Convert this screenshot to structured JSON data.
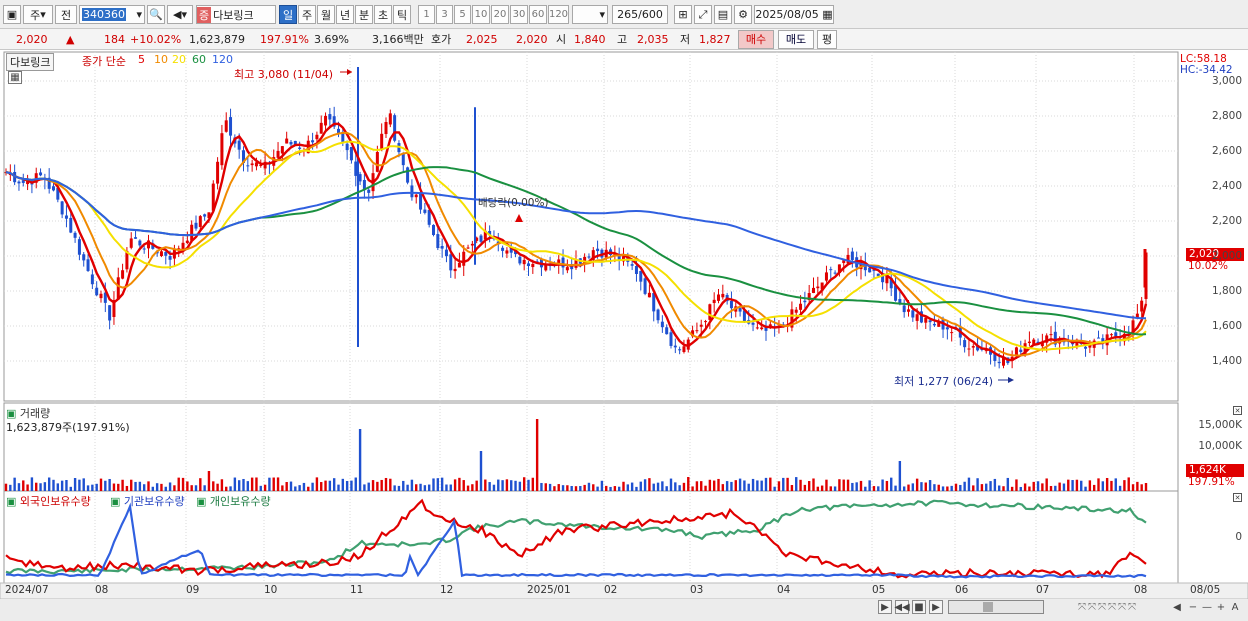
{
  "toolbar": {
    "market_type": "주",
    "unit": "전",
    "code": "340360",
    "stock_name": "다보링크",
    "stock_badge": "증",
    "periods": [
      "일",
      "주",
      "월",
      "년",
      "분",
      "초",
      "틱"
    ],
    "active_period": "일",
    "minute_steps": [
      "1",
      "3",
      "5",
      "10",
      "20",
      "30",
      "60",
      "120"
    ],
    "count": "265",
    "count_max": "/600",
    "date": "2025/08/05"
  },
  "quote": {
    "price": "2,020",
    "change_arrow": "▲",
    "change": "184",
    "change_pct": "+10.02%",
    "volume": "1,623,879",
    "volume_ratio": "197.91%",
    "turnover": "3.69%",
    "amount": "3,166백만",
    "bid_label": "호가",
    "bid": "2,025",
    "ask": "2,020",
    "open_label": "시",
    "open": "1,840",
    "high_label": "고",
    "high": "2,035",
    "low_label": "저",
    "low": "1,827",
    "buy_label": "매수",
    "sell_label": "매도",
    "eval_label": "평"
  },
  "legend": {
    "name": "다보링크",
    "ma_title": "종가 단순",
    "ma_periods": [
      "5",
      "10",
      "20",
      "60",
      "120"
    ]
  },
  "annotations": {
    "high": "최고 3,080 (11/04)",
    "low": "최저 1,277 (06/24)",
    "dividend": "배당락(0.00%)",
    "lc": "LC:58.18",
    "hc": "HC:-34.42"
  },
  "price_tag": {
    "price": "2,020",
    "pct": "10.02%"
  },
  "y_axis": [
    "3,000",
    "2,800",
    "2,600",
    "2,400",
    "2,200",
    "2,000",
    "1,800",
    "1,600",
    "1,400"
  ],
  "volume_panel": {
    "title": "거래량",
    "value": "1,623,879주(197.91%)",
    "y_axis": [
      "15,000K",
      "10,000K"
    ],
    "tag_value": "1,624K",
    "tag_pct": "197.91%"
  },
  "holdings_panel": {
    "series": [
      "외국인보유수량",
      "기관보유수량",
      "개인보유수량"
    ],
    "y_axis": [
      "0"
    ]
  },
  "x_axis": [
    "2024/07",
    "08",
    "09",
    "10",
    "11",
    "12",
    "2025/01",
    "02",
    "03",
    "04",
    "05",
    "06",
    "07",
    "08",
    "08/05"
  ],
  "colors": {
    "up": "#e00000",
    "down": "#1e50d0",
    "ma5": "#e00000",
    "ma10": "#f08a00",
    "ma20": "#f5e000",
    "ma60": "#1a9040",
    "ma120": "#3060e0",
    "foreign": "#e00000",
    "inst": "#3060e0",
    "indiv": "#40a070"
  }
}
